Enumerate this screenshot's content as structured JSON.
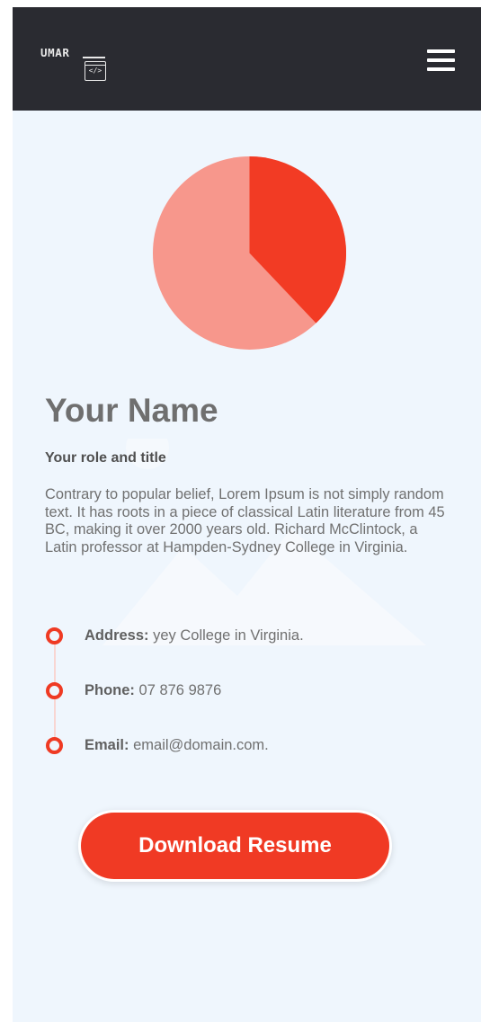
{
  "header": {
    "logo_text": "UMAR",
    "logo_code": "</>",
    "menu_icon": "hamburger-icon",
    "background": "#2a2b31"
  },
  "profile": {
    "chart_icon": "pie-chart-illustration",
    "name": "Your Name",
    "role": "Your role and title",
    "bio": "Contrary to popular belief, Lorem Ipsum is not simply random text. It has roots in a piece of classical Latin literature from 45 BC, making it over 2000 years old. Richard McClintock, a Latin professor at Hampden-Sydney College in Virginia."
  },
  "contact": {
    "items": [
      {
        "label": "Address:",
        "value": "yey College in Virginia."
      },
      {
        "label": "Phone:",
        "value": "07 876 9876"
      },
      {
        "label": "Email:",
        "value": "email@domain.com."
      }
    ]
  },
  "actions": {
    "download_label": "Download Resume"
  },
  "colors": {
    "accent": "#f03a24",
    "pie_light": "#f7978c",
    "page_background": "#eff6fd"
  }
}
